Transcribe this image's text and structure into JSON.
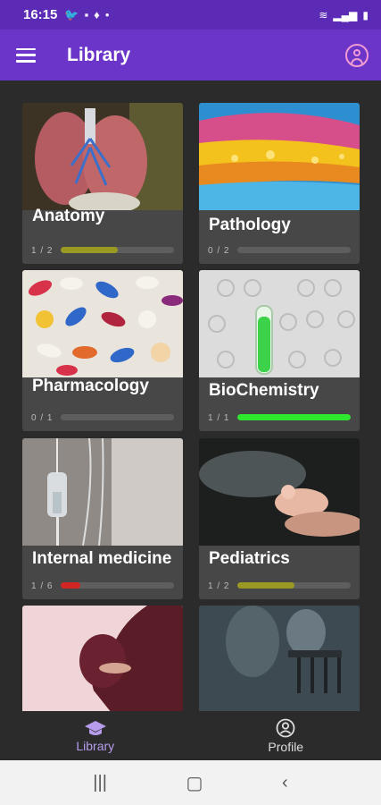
{
  "status": {
    "time": "16:15"
  },
  "app_bar": {
    "title": "Library"
  },
  "cards": [
    {
      "name": "Anatomy",
      "progress_text": "1 / 2",
      "progress": 0.5
    },
    {
      "name": "Pathology",
      "progress_text": "0 / 2",
      "progress": 0
    },
    {
      "name": "Pharmacology",
      "progress_text": "0 / 1",
      "progress": 0
    },
    {
      "name": "BioChemistry",
      "progress_text": "1 / 1",
      "progress": 1
    },
    {
      "name": "Internal medicine",
      "progress_text": "1 / 6",
      "progress": 0.17
    },
    {
      "name": "Pediatrics",
      "progress_text": "1 / 2",
      "progress": 0.5
    },
    {
      "name": "",
      "progress_text": "",
      "progress": null
    },
    {
      "name": "",
      "progress_text": "",
      "progress": null
    }
  ],
  "bottom_nav": {
    "library_label": "Library",
    "profile_label": "Profile"
  },
  "colors": {
    "accent": "#6c35c9",
    "complete": "#2ee82e",
    "partial": "#9a9a23",
    "low": "#d42525",
    "active_nav": "#b79cec"
  }
}
